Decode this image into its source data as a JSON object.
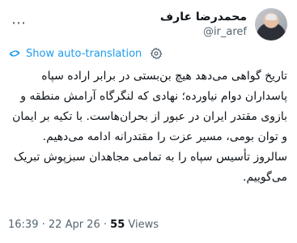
{
  "author": {
    "name": "محمدرضا عارف",
    "handle": "@ir_aref"
  },
  "translation": {
    "label": "Show auto-translation"
  },
  "tweet": {
    "text": "تاریخ گواهی می‌دهد هیچ بن‌بستی در برابر اراده سپاه پاسداران  دوام نیاورده؛ نهادی که لنگرگاه آرامش منطقه و بازوی مقتدر ایران در عبور از بحران‌هاست. با تکیه بر ایمان و توان بومی، مسیر عزت را مقتدرانه ادامه می‌دهیم. سالروز تأسیس سپاه را به تمامی مجاهدان سبزپوش تبریک می‌گوییم."
  },
  "meta": {
    "time": "16:39",
    "separator": "·",
    "date": "22 Apr 26",
    "views_count": "55",
    "views_label": "Views"
  },
  "icons": {
    "more": "more-options-icon",
    "translate": "translate-icon",
    "settings": "gear-icon"
  },
  "colors": {
    "link": "#1d9bf0",
    "secondary": "#536471",
    "text": "#0f1419"
  }
}
